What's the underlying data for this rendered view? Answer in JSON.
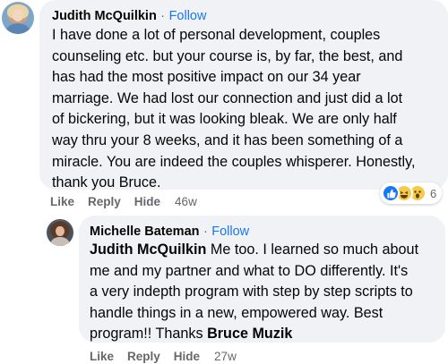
{
  "comments": [
    {
      "author": "Judith McQuilkin",
      "separator": "·",
      "follow_label": "Follow",
      "lines": [
        "I have done a lot of personal development, couples",
        "counseling etc. but your course is, by far, the best, and",
        "has had the most positive impact on our 34 year",
        "marriage. We had lost our connection and just did a lot",
        "of bickering, but it was looking bleak. We are only half",
        "way thru your 8 weeks, and it has been something of a",
        "miracle. You are indeed the couples whisperer. Honestly,",
        "thank you Bruce."
      ],
      "reaction_count": "6",
      "reaction_icons": [
        "like-icon",
        "haha-icon",
        "wow-icon"
      ],
      "actions": {
        "like": "Like",
        "reply": "Reply",
        "hide": "Hide",
        "time": "46w"
      }
    },
    {
      "author": "Michelle Bateman",
      "separator": "·",
      "follow_label": "Follow",
      "mention_start": "Judith McQuilkin",
      "line1_rest": " Me too. I learned so much about",
      "lines": [
        "me and my partner and what to DO differently. It's",
        "a very indepth program with step by step scripts to",
        "handle things in a new, empowered way. Best"
      ],
      "last_line_prefix": "program!! Thanks ",
      "mention_end": "Bruce Muzik",
      "actions": {
        "like": "Like",
        "reply": "Reply",
        "hide": "Hide",
        "time": "27w"
      }
    }
  ],
  "colors": {
    "bubble": "#f0f2f5",
    "follow": "#1877f2",
    "meta": "#65676b",
    "like_blue": "#1877f2",
    "emoji_yellow": "#f7c94a"
  }
}
